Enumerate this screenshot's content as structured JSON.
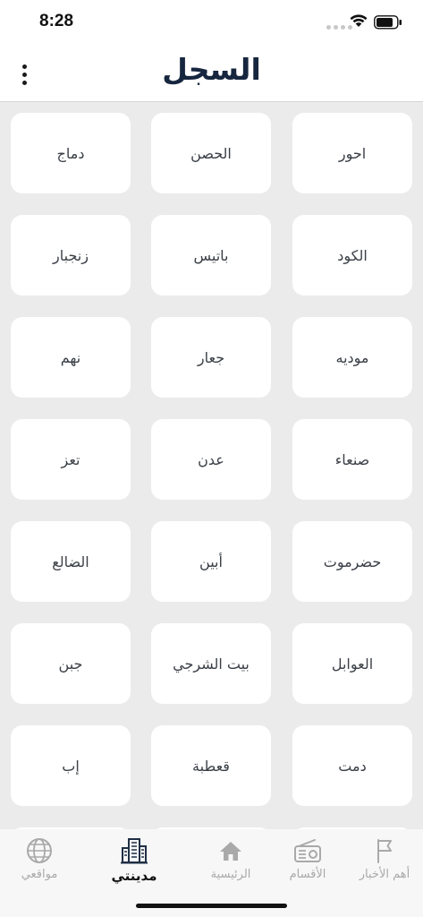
{
  "status_bar": {
    "time": "8:28"
  },
  "header": {
    "title": "السجل"
  },
  "cities": [
    "احور",
    "الحصن",
    "دماج",
    "الكود",
    "باتيس",
    "زنجبار",
    "موديه",
    "جعار",
    "نهم",
    "صنعاء",
    "عدن",
    "تعز",
    "حضرموت",
    "أبين",
    "الضالع",
    "العوابل",
    "بيت الشرجي",
    "جبن",
    "دمت",
    "قعطبة",
    "إب"
  ],
  "bottom_nav": {
    "items": [
      {
        "label": "أهم الأخبار",
        "icon": "flag-icon",
        "active": false
      },
      {
        "label": "الأقسام",
        "icon": "radio-icon",
        "active": false
      },
      {
        "label": "الرئيسية",
        "icon": "home-icon",
        "active": false
      },
      {
        "label": "مدينتي",
        "icon": "city-buildings-icon",
        "active": true
      },
      {
        "label": "مواقعي",
        "icon": "globe-icon",
        "active": false
      }
    ]
  },
  "colors": {
    "title": "#16263f",
    "background": "#ebebeb",
    "card": "#ffffff",
    "nav_inactive": "#a9a9a9"
  }
}
